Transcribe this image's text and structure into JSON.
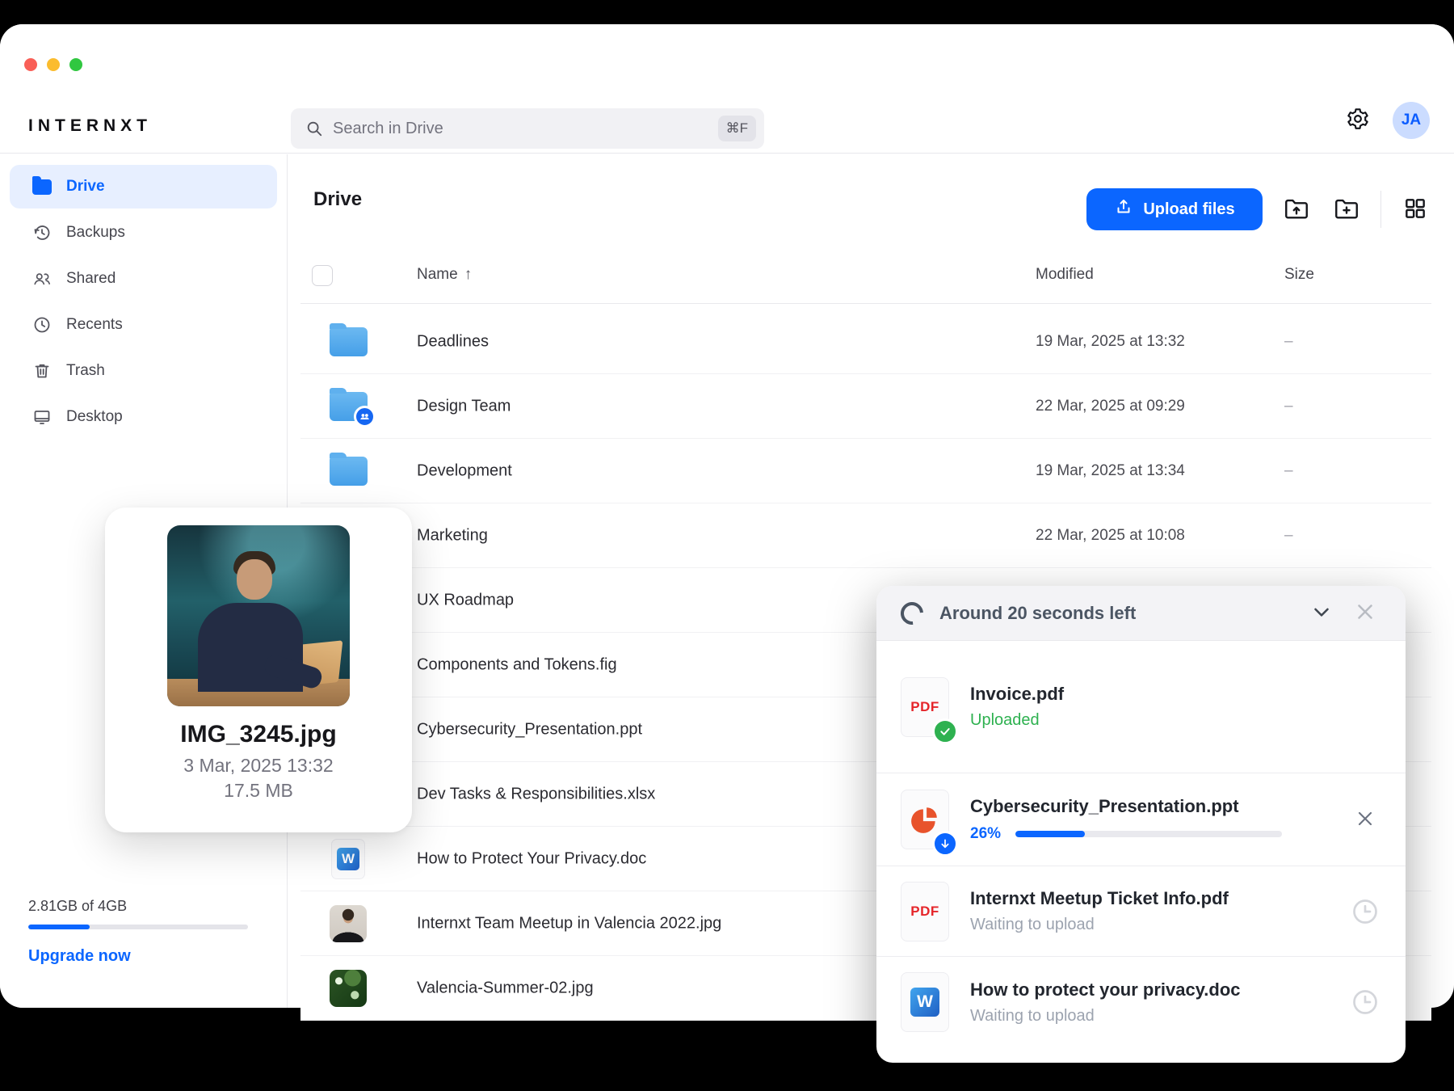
{
  "brand": "INTERNXT",
  "topbar": {
    "search_placeholder": "Search in Drive",
    "search_shortcut": "⌘F",
    "avatar_initials": "JA"
  },
  "sidebar": {
    "items": [
      {
        "label": "Drive",
        "active": true
      },
      {
        "label": "Backups",
        "active": false
      },
      {
        "label": "Shared",
        "active": false
      },
      {
        "label": "Recents",
        "active": false
      },
      {
        "label": "Trash",
        "active": false
      },
      {
        "label": "Desktop",
        "active": false
      }
    ],
    "storage": {
      "usage": "2.81GB of 4GB",
      "percent": 28,
      "upgrade_label": "Upgrade now"
    }
  },
  "main": {
    "title": "Drive",
    "upload_button": "Upload files",
    "table": {
      "columns": {
        "name": "Name",
        "sort_arrow": "↑",
        "modified": "Modified",
        "size": "Size"
      },
      "rows": [
        {
          "name": "Deadlines",
          "modified": "19 Mar, 2025 at 13:32",
          "size": "–"
        },
        {
          "name": "Design Team",
          "modified": "22 Mar, 2025 at 09:29",
          "size": "–"
        },
        {
          "name": "Development",
          "modified": "19 Mar, 2025 at 13:34",
          "size": "–"
        },
        {
          "name": "Marketing",
          "modified": "22 Mar, 2025 at 10:08",
          "size": "–"
        },
        {
          "name": "UX Roadmap",
          "modified": "",
          "size": ""
        },
        {
          "name": "Components and Tokens.fig",
          "modified": "",
          "size": ""
        },
        {
          "name": "Cybersecurity_Presentation.ppt",
          "modified": "",
          "size": ""
        },
        {
          "name": "Dev Tasks & Responsibilities.xlsx",
          "modified": "",
          "size": ""
        },
        {
          "name": "How to Protect Your Privacy.doc",
          "modified": "",
          "size": ""
        },
        {
          "name": "Internxt Team Meetup in Valencia 2022.jpg",
          "modified": "",
          "size": ""
        },
        {
          "name": "Valencia-Summer-02.jpg",
          "modified": "",
          "size": ""
        }
      ]
    }
  },
  "preview_card": {
    "filename": "IMG_3245.jpg",
    "date": "3 Mar, 2025 13:32",
    "size": "17.5 MB"
  },
  "upload_panel": {
    "status": "Around 20 seconds left",
    "items": [
      {
        "name": "Invoice.pdf",
        "status": "Uploaded",
        "file_type": "pdf",
        "state": "done"
      },
      {
        "name": "Cybersecurity_Presentation.ppt",
        "progress_label": "26%",
        "progress": 26,
        "file_type": "ppt",
        "state": "uploading"
      },
      {
        "name": "Internxt Meetup Ticket Info.pdf",
        "status": "Waiting to upload",
        "file_type": "pdf",
        "state": "waiting"
      },
      {
        "name": "How to protect your privacy.doc",
        "status": "Waiting to upload",
        "file_type": "doc",
        "state": "waiting"
      }
    ]
  },
  "colors": {
    "accent_blue": "#0b66ff",
    "success_green": "#2eb150",
    "pdf_red": "#e5252a",
    "ppt_orange": "#e8532c",
    "folder_blue": "#459fe8"
  }
}
